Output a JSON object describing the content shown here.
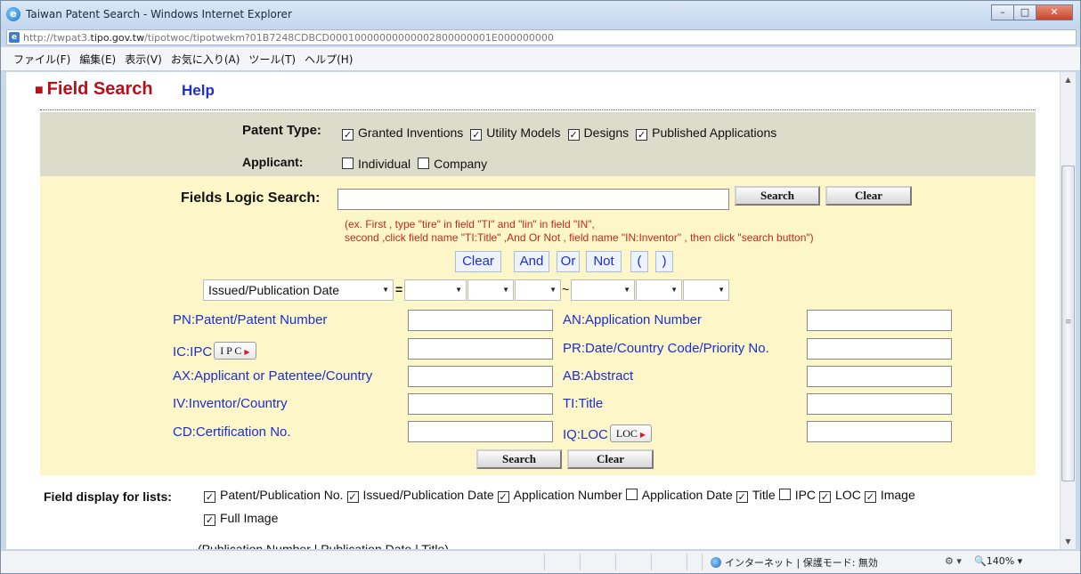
{
  "window": {
    "title": "Taiwan Patent Search - Windows Internet Explorer",
    "url_prefix": "http://twpat3.",
    "url_domain": "tipo.gov.tw",
    "url_path": "/tipotwoc/tipotwekm?01B7248CDBCD00010000000000002800000001E000000000"
  },
  "menu": [
    "ファイル(F)",
    "編集(E)",
    "表示(V)",
    "お気に入り(A)",
    "ツール(T)",
    "ヘルプ(H)"
  ],
  "page": {
    "heading_bullet": "■",
    "heading": "Field Search",
    "help": "Help"
  },
  "filters": {
    "patent_type_label": "Patent Type:",
    "patent_types": [
      {
        "label": "Granted Inventions",
        "checked": true
      },
      {
        "label": "Utility Models",
        "checked": true
      },
      {
        "label": "Designs",
        "checked": true
      },
      {
        "label": "Published Applications",
        "checked": true
      }
    ],
    "applicant_label": "Applicant:",
    "applicants": [
      {
        "label": "Individual",
        "checked": false
      },
      {
        "label": "Company",
        "checked": false
      }
    ]
  },
  "logic": {
    "label": "Fields Logic Search:",
    "value": "",
    "search": "Search",
    "clear": "Clear",
    "hint1": "(ex. First , type \"tire\" in field \"TI\" and \"lin\" in field \"IN\",",
    "hint2": "second ,click field name \"TI:Title\" ,And Or Not , field name \"IN:Inventor\" , then click \"search button\")",
    "ops": [
      "Clear",
      "And",
      "Or",
      "Not",
      "(",
      ")"
    ]
  },
  "date": {
    "field": "Issued/Publication Date",
    "eq": "=",
    "tilde": "~"
  },
  "fields_left": [
    {
      "label": "PN:Patent/Patent Number"
    },
    {
      "label": "IC:IPC",
      "button": "I P C"
    },
    {
      "label": "AX:Applicant or Patentee/Country"
    },
    {
      "label": "IV:Inventor/Country"
    },
    {
      "label": "CD:Certification No."
    }
  ],
  "fields_right": [
    {
      "label": "AN:Application Number"
    },
    {
      "label": "PR:Date/Country Code/Priority No."
    },
    {
      "label": "AB:Abstract"
    },
    {
      "label": "TI:Title"
    },
    {
      "label": "IQ:LOC",
      "button": "LOC"
    }
  ],
  "bottom": {
    "search": "Search",
    "clear": "Clear"
  },
  "display": {
    "label": "Field display for lists:",
    "options": [
      {
        "label": "Patent/Publication No.",
        "checked": true
      },
      {
        "label": "Issued/Publication Date",
        "checked": true
      },
      {
        "label": "Application Number",
        "checked": true
      },
      {
        "label": "Application Date",
        "checked": false
      },
      {
        "label": "Title",
        "checked": true
      },
      {
        "label": "IPC",
        "checked": false
      },
      {
        "label": "LOC",
        "checked": true
      },
      {
        "label": "Image",
        "checked": true
      }
    ],
    "option_last": {
      "label": "Full Image",
      "checked": true
    },
    "cutoff_text": "(Publication Number | Publication Date | Title)"
  },
  "status": {
    "zone": "インターネット | 保護モード: 無効",
    "zoom": "140%"
  }
}
